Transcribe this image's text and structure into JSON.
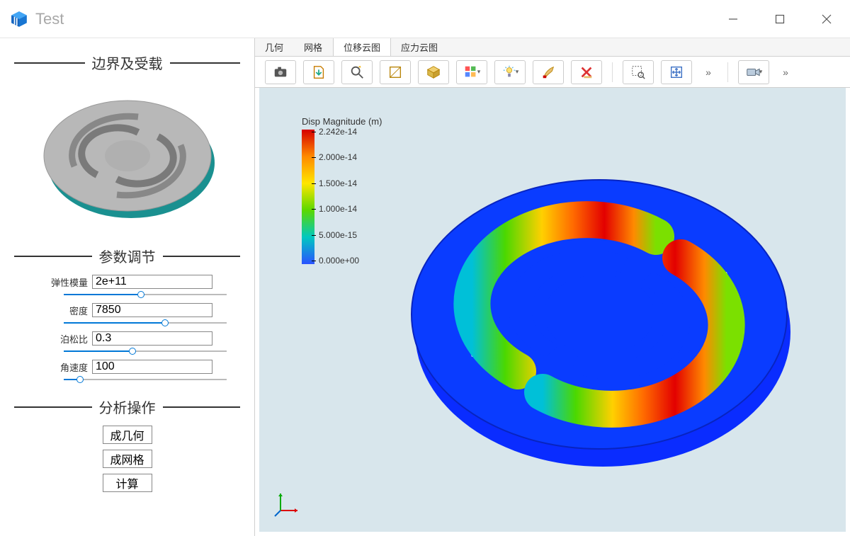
{
  "titlebar": {
    "title": "Test"
  },
  "sidebar": {
    "section1_title": "边界及受载",
    "section2_title": "参数调节",
    "section3_title": "分析操作",
    "params": {
      "elastic_modulus": {
        "label": "弹性模量",
        "value": "2e+11",
        "fillPct": 45
      },
      "density": {
        "label": "密度",
        "value": "7850",
        "fillPct": 60
      },
      "poisson": {
        "label": "泊松比",
        "value": "0.3",
        "fillPct": 40
      },
      "angular_vel": {
        "label": "角速度",
        "value": "100",
        "fillPct": 8
      }
    },
    "ops": {
      "gen_geom": "成几何",
      "gen_mesh": "成网格",
      "compute": "计算"
    }
  },
  "tabs": [
    "几何",
    "网格",
    "位移云图",
    "应力云图"
  ],
  "active_tab_index": 2,
  "toolbar_icons": [
    "camera-icon",
    "export-icon",
    "zoom-icon",
    "box-select-icon",
    "cube-icon",
    "blocks-icon",
    "light-icon",
    "brush-icon",
    "delete-icon",
    "select-zoom-icon",
    "fit-icon",
    "more-icon",
    "camera-view-icon",
    "more2-icon"
  ],
  "legend": {
    "title": "Disp Magnitude (m)",
    "ticks": [
      "2.242e-14",
      "2.000e-14",
      "1.500e-14",
      "1.000e-14",
      "5.000e-15",
      "0.000e+00"
    ]
  },
  "chart_data": {
    "type": "heatmap",
    "title": "Disp Magnitude (m)",
    "colormap": "jet",
    "range_min": 0.0,
    "range_max": 2.242e-14,
    "tick_values": [
      2.242e-14,
      2e-14,
      1.5e-14,
      1e-14,
      5e-15,
      0.0
    ],
    "field": "displacement_magnitude",
    "units": "m"
  }
}
